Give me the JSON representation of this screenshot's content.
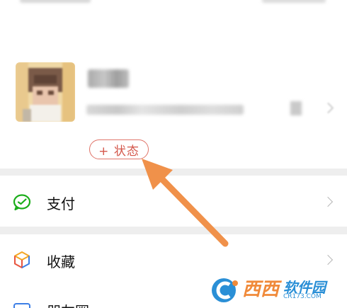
{
  "status_button": {
    "label": "+ 状态"
  },
  "menu": {
    "items": [
      {
        "label": "支付",
        "icon": "wechat-pay-icon"
      },
      {
        "label": "收藏",
        "icon": "favorites-cube-icon"
      },
      {
        "label": "朋友圈",
        "icon": "moments-icon"
      }
    ]
  },
  "watermark": {
    "main": "西西",
    "brand": "软件园",
    "domain": "CR173.COM"
  },
  "colors": {
    "status_accent": "#e0756a",
    "arrow": "#f0914a",
    "pay_green": "#1aad19",
    "separator": "#eeeeee"
  }
}
